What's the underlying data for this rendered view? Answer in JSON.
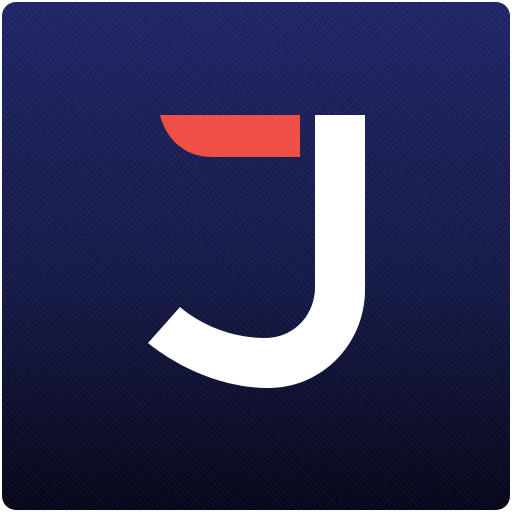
{
  "app_icon": {
    "logo_icon": "letter-j-logo-icon",
    "colors": {
      "background_top": "#202568",
      "background_bottom": "#06071a",
      "letter": "#ffffff",
      "accent": "#ef4f45"
    }
  }
}
